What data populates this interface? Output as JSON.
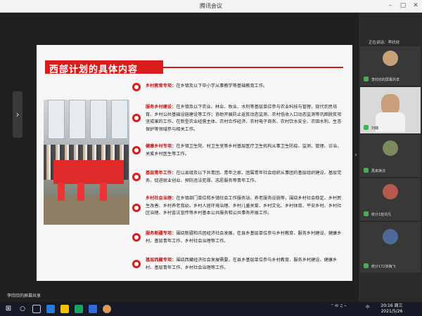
{
  "window": {
    "title": "腾讯会议"
  },
  "slide": {
    "title": "西部计划的具体内容",
    "items": [
      {
        "head": "乡村教育专项：",
        "body": "在乡镇及以下中小学从事教学等基础教育工作。"
      },
      {
        "head": "服务乡村建设：",
        "body": "在乡镇及以下农业、林业、牧业、水利等基层单位参与农业科技与管理，现代农民培育、乡村公共基础设施建设等工作；协助开展防止返贫动态监测、农村低收入口动态监测等巩固脱贫攻坚成果的工作。在新型农业经营主体、农村合作经济、农村电子商务、农村饮水安全、农田水利、生态保护等领域参与相关工作。"
      },
      {
        "head": "健康乡村专项：",
        "body": "在乡镇卫生院、村卫生室等乡村基层医疗卫生机构从事卫生防疫、监测、管理、诊治、关爱乡村医生等工作。"
      },
      {
        "head": "基层青年工作：",
        "body": "在以县级及以下共青团、青年之家、团属青年社会组织从事团的基层组织建设、基层党务、促进就业创业、预防违法犯罪、志愿服务等青年工作。"
      },
      {
        "head": "乡村社会治理：",
        "body": "在乡镇部门单位和乡镇社会工作服务站、养老服务设施等，围绕乡村社会稳定、乡村民生改善、乡村养老育幼、乡村人居环境治理、乡村儿童关爱、乡村文化、乡村体育、平安乡村、乡村社区治理、乡村普法宣传等乡村基本公共服务和公共事务开展工作。"
      },
      {
        "head": "服务新疆专项：",
        "body": "围绕新疆和兵团经济社会发展，在县乡基层单位参与乡村教育、服务乡村建设、健康乡村、基层青年工作、乡村社会治理等工作。"
      },
      {
        "head": "基层西藏专项：",
        "body": "围绕西藏经济社会发展需要，在县乡基层单位参与乡村教育、服务乡村建设、健康乡村、基层青年工作、乡村社会治理等工作。"
      }
    ]
  },
  "panel": {
    "speaking_label": "正在讲话：李欣欣",
    "participants": [
      {
        "name": "李欣欣的屏幕共享"
      },
      {
        "name": "刘璐"
      },
      {
        "name": "再来换法"
      },
      {
        "name": "统计1班刘凡"
      },
      {
        "name": "统计172张梅飞"
      }
    ]
  },
  "share_label": "李欣欣的屏幕共享",
  "taskbar": {
    "time": "20:16 周三",
    "date": "2021/5/26",
    "lang": "中"
  },
  "colors": {
    "accent": "#d91c1c",
    "mic_on": "#3fb34f"
  },
  "icons": [
    "windows-icon",
    "search-icon",
    "task-view-icon",
    "edge-icon",
    "explorer-icon",
    "meeting-icon",
    "chevron-left-icon",
    "chevron-right-icon"
  ]
}
